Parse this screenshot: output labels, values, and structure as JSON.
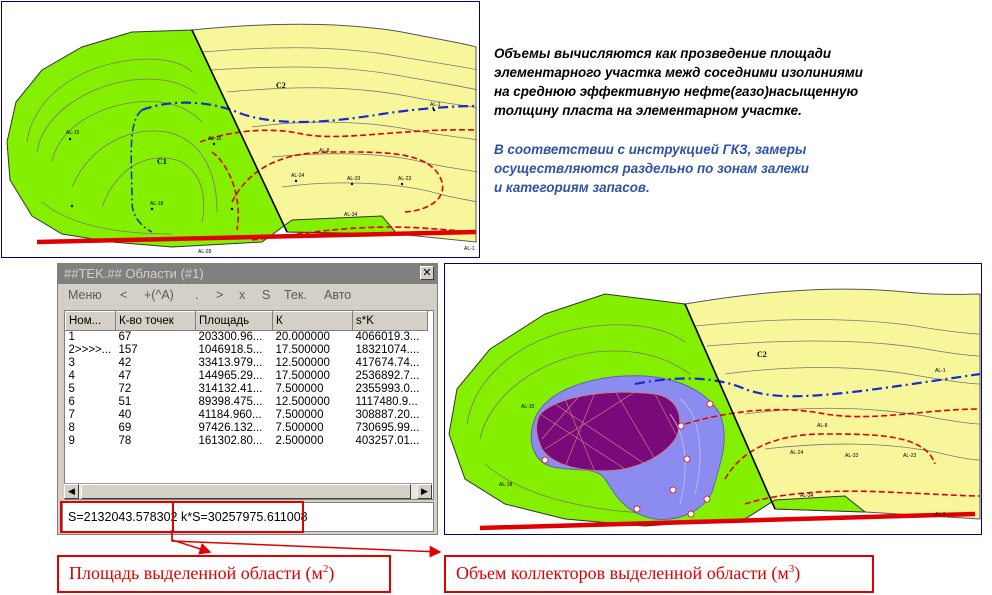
{
  "note": {
    "line1": "Объемы вычисляются как прозведение площади",
    "line2": "элементарного участка межд соседними изолиниями",
    "line3": "на среднюю эффективную нефте(газо)насыщенную",
    "line4": "толщину пласта на элементарном участке.",
    "line5": "В соответствии с инструкцией ГКЗ, замеры",
    "line6": "осуществляются  раздельно по зонам залежи",
    "line7": "и категориям запасов."
  },
  "map_labels": {
    "c1": "C1",
    "c2": "C2",
    "wells": [
      "AL-15",
      "AL-16",
      "AL-1",
      "AL-24",
      "AL-33",
      "AL-23",
      "AL-34",
      "AL-18",
      "AL-28",
      "AL-1",
      "AL-8"
    ]
  },
  "window": {
    "title": "##TEK.## Области (#1)",
    "close": "✕",
    "menu": [
      "Меню",
      "<",
      "+(^A)",
      ".",
      ">",
      "x",
      "S",
      "Тек.",
      "Авто"
    ],
    "columns": [
      "Ном...",
      "К-во точек",
      "Площадь",
      "К",
      "s*K"
    ],
    "rows": [
      [
        "1",
        "67",
        "203300.96...",
        "20.000000",
        "4066019.3..."
      ],
      [
        "2>>>>...",
        "157",
        "1046918.5...",
        "17.500000",
        "18321074...."
      ],
      [
        "3",
        "42",
        "33413.979...",
        "12.500000",
        "417674.74..."
      ],
      [
        "4",
        "47",
        "144965.29...",
        "17.500000",
        "2536892.7..."
      ],
      [
        "5",
        "72",
        "314132.41...",
        "7.500000",
        "2355993.0..."
      ],
      [
        "6",
        "51",
        "89398.475...",
        "12.500000",
        "1117480.9..."
      ],
      [
        "7",
        "40",
        "41184.960...",
        "7.500000",
        "308887.20..."
      ],
      [
        "8",
        "69",
        "97426.132...",
        "7.500000",
        "730695.99..."
      ],
      [
        "9",
        "78",
        "161302.80...",
        "2.500000",
        "403257.01..."
      ]
    ],
    "status_s": "S=2132043.578302",
    "status_ks": "k*S=30257975.611008"
  },
  "labels": {
    "area_text": "Площадь выделенной области (м",
    "area_sup": "2",
    "area_close": ")",
    "volume_text": "Объем коллекторов выделенной области (м",
    "volume_sup": "3",
    "volume_close": ")"
  },
  "colors": {
    "green": "#84f000",
    "yellow": "#f8f69a",
    "purple": "#7a0a7a",
    "lavender": "#8c8cf0",
    "red": "#e00000",
    "blue_dash": "#1a2bd0",
    "note_blue": "#2e52a8"
  }
}
